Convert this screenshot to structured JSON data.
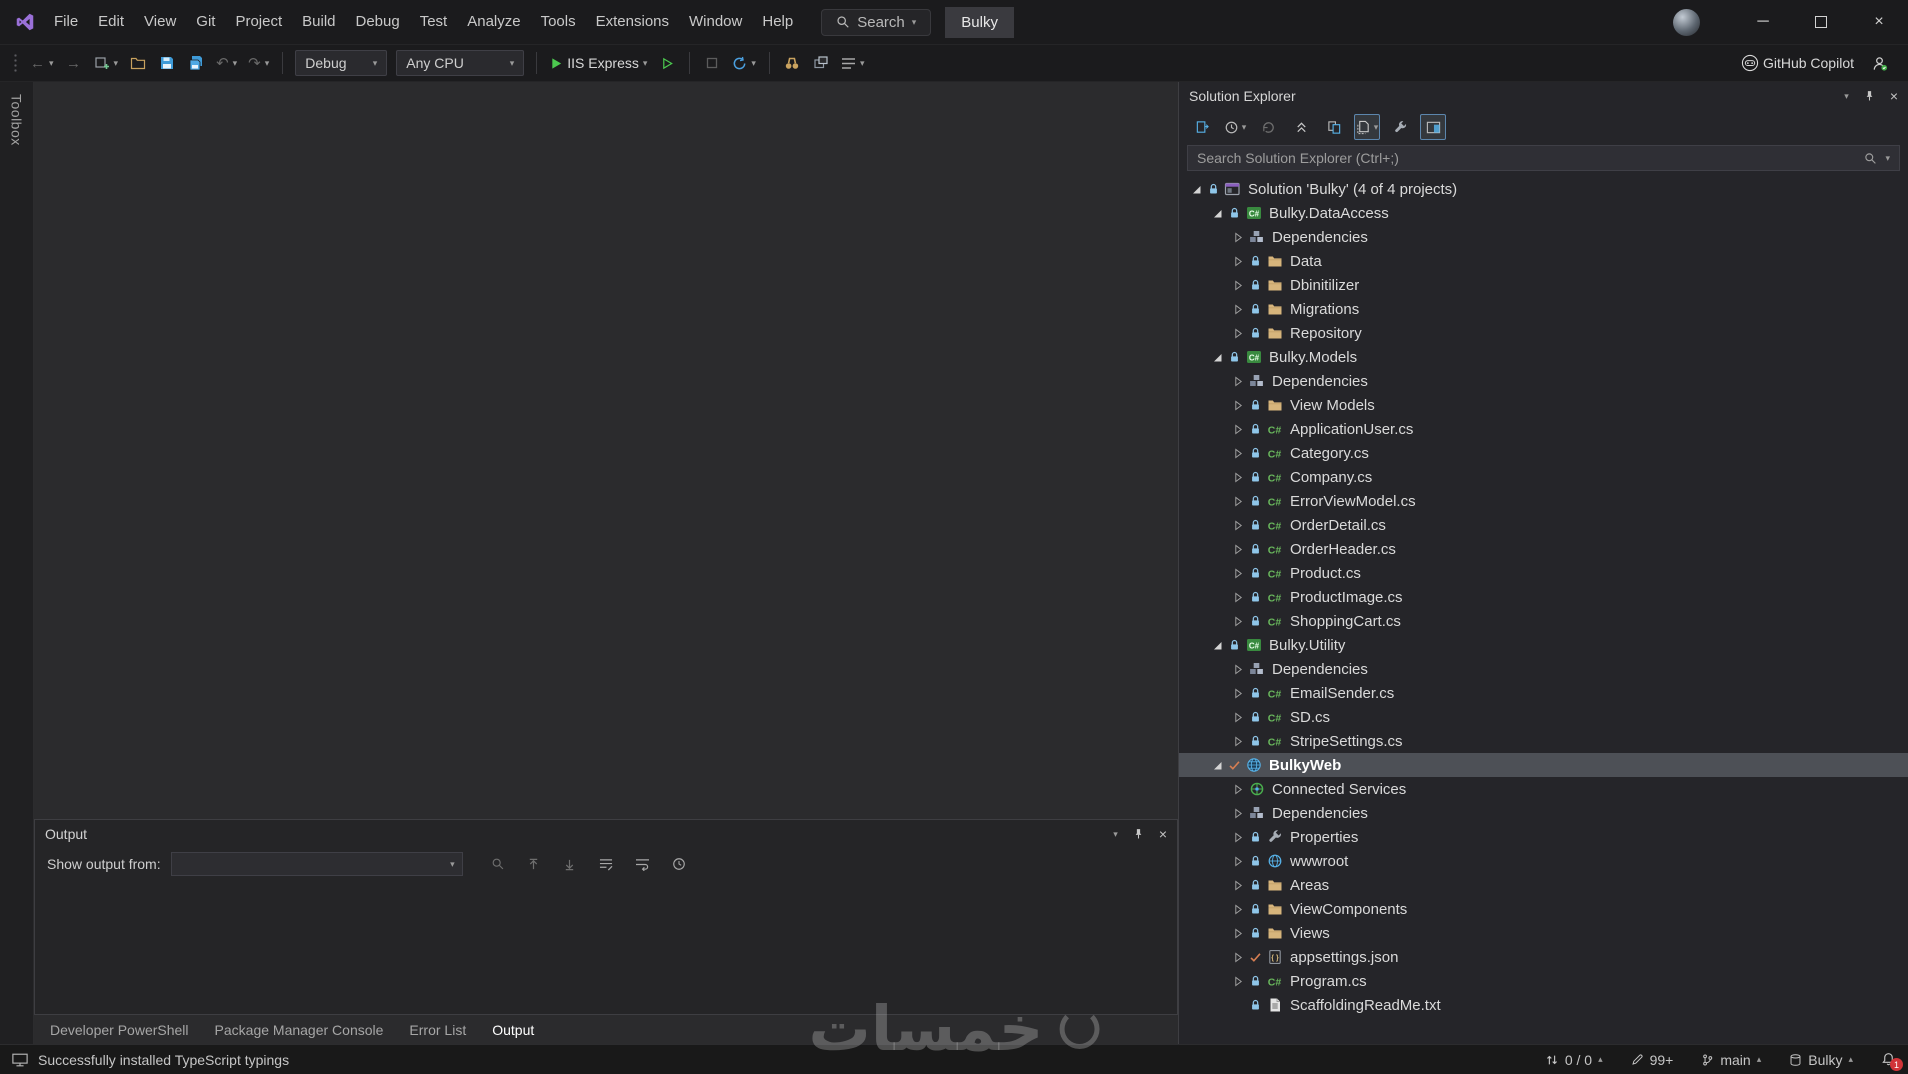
{
  "icons": {
    "caret_down": "▾",
    "caret_up": "▴",
    "close": "×",
    "minimize": "─",
    "back_arrow": "←",
    "forward_arrow": "→",
    "undo": "↶",
    "redo": "↷"
  },
  "accent_colors": {
    "folder": "#d7b57c",
    "csharp_green": "#69b75c",
    "run_green": "#4cc94f",
    "save_blue": "#3f9bd8",
    "lock_blue": "#8fc6e9",
    "check_orange": "#d67e52",
    "selection_gray": "#4d5056"
  },
  "titlebar": {
    "menus": [
      "File",
      "Edit",
      "View",
      "Git",
      "Project",
      "Build",
      "Debug",
      "Test",
      "Analyze",
      "Tools",
      "Extensions",
      "Window",
      "Help"
    ],
    "search": {
      "label": "Search"
    },
    "solution_name": "Bulky"
  },
  "toolbar": {
    "configuration": "Debug",
    "platform": "Any CPU",
    "start_button": "IIS Express",
    "copilot": "GitHub Copilot"
  },
  "left_rail": {
    "toolbox_label": "Toolbox"
  },
  "solution_explorer": {
    "title": "Solution Explorer",
    "search_placeholder": "Search Solution Explorer (Ctrl+;)",
    "tree": [
      {
        "label": "Solution 'Bulky' (4 of 4 projects)",
        "level": 0,
        "expand": "expanded",
        "lock": true,
        "icon": "solution"
      },
      {
        "label": "Bulky.DataAccess",
        "level": 1,
        "expand": "expanded",
        "lock": true,
        "icon": "csproject"
      },
      {
        "label": "Dependencies",
        "level": 2,
        "expand": "collapsed",
        "icon": "dependencies"
      },
      {
        "label": "Data",
        "level": 2,
        "expand": "collapsed",
        "lock": true,
        "icon": "folder"
      },
      {
        "label": "Dbinitilizer",
        "level": 2,
        "expand": "collapsed",
        "lock": true,
        "icon": "folder"
      },
      {
        "label": "Migrations",
        "level": 2,
        "expand": "collapsed",
        "lock": true,
        "icon": "folder"
      },
      {
        "label": "Repository",
        "level": 2,
        "expand": "collapsed",
        "lock": true,
        "icon": "folder"
      },
      {
        "label": "Bulky.Models",
        "level": 1,
        "expand": "expanded",
        "lock": true,
        "icon": "csproject"
      },
      {
        "label": "Dependencies",
        "level": 2,
        "expand": "collapsed",
        "icon": "dependencies"
      },
      {
        "label": "View Models",
        "level": 2,
        "expand": "collapsed",
        "lock": true,
        "icon": "folder"
      },
      {
        "label": "ApplicationUser.cs",
        "level": 2,
        "expand": "collapsed",
        "lock": true,
        "icon": "csharp"
      },
      {
        "label": "Category.cs",
        "level": 2,
        "expand": "collapsed",
        "lock": true,
        "icon": "csharp"
      },
      {
        "label": "Company.cs",
        "level": 2,
        "expand": "collapsed",
        "lock": true,
        "icon": "csharp"
      },
      {
        "label": "ErrorViewModel.cs",
        "level": 2,
        "expand": "collapsed",
        "lock": true,
        "icon": "csharp"
      },
      {
        "label": "OrderDetail.cs",
        "level": 2,
        "expand": "collapsed",
        "lock": true,
        "icon": "csharp"
      },
      {
        "label": "OrderHeader.cs",
        "level": 2,
        "expand": "collapsed",
        "lock": true,
        "icon": "csharp"
      },
      {
        "label": "Product.cs",
        "level": 2,
        "expand": "collapsed",
        "lock": true,
        "icon": "csharp"
      },
      {
        "label": "ProductImage.cs",
        "level": 2,
        "expand": "collapsed",
        "lock": true,
        "icon": "csharp"
      },
      {
        "label": "ShoppingCart.cs",
        "level": 2,
        "expand": "collapsed",
        "lock": true,
        "icon": "csharp"
      },
      {
        "label": "Bulky.Utility",
        "level": 1,
        "expand": "expanded",
        "lock": true,
        "icon": "csproject"
      },
      {
        "label": "Dependencies",
        "level": 2,
        "expand": "collapsed",
        "icon": "dependencies"
      },
      {
        "label": "EmailSender.cs",
        "level": 2,
        "expand": "collapsed",
        "lock": true,
        "icon": "csharp"
      },
      {
        "label": "SD.cs",
        "level": 2,
        "expand": "collapsed",
        "lock": true,
        "icon": "csharp"
      },
      {
        "label": "StripeSettings.cs",
        "level": 2,
        "expand": "collapsed",
        "lock": true,
        "icon": "csharp"
      },
      {
        "label": "BulkyWeb",
        "level": 1,
        "expand": "expanded",
        "check": true,
        "icon": "webproject",
        "selected": true,
        "bold": true
      },
      {
        "label": "Connected Services",
        "level": 2,
        "expand": "collapsed",
        "icon": "connected"
      },
      {
        "label": "Dependencies",
        "level": 2,
        "expand": "collapsed",
        "icon": "dependencies"
      },
      {
        "label": "Properties",
        "level": 2,
        "expand": "collapsed",
        "lock": true,
        "icon": "properties"
      },
      {
        "label": "wwwroot",
        "level": 2,
        "expand": "collapsed",
        "lock": true,
        "icon": "globe"
      },
      {
        "label": "Areas",
        "level": 2,
        "expand": "collapsed",
        "lock": true,
        "icon": "folder"
      },
      {
        "label": "ViewComponents",
        "level": 2,
        "expand": "collapsed",
        "lock": true,
        "icon": "folder"
      },
      {
        "label": "Views",
        "level": 2,
        "expand": "collapsed",
        "lock": true,
        "icon": "folder"
      },
      {
        "label": "appsettings.json",
        "level": 2,
        "expand": "collapsed",
        "check": true,
        "icon": "json"
      },
      {
        "label": "Program.cs",
        "level": 2,
        "expand": "collapsed",
        "lock": true,
        "icon": "csharp"
      },
      {
        "label": "ScaffoldingReadMe.txt",
        "level": 2,
        "expand": "none",
        "lock": true,
        "icon": "textfile"
      }
    ]
  },
  "output_panel": {
    "title": "Output",
    "show_output_from": "Show output from:",
    "source_value": "",
    "tabs": [
      {
        "label": "Developer PowerShell",
        "active": false
      },
      {
        "label": "Package Manager Console",
        "active": false
      },
      {
        "label": "Error List",
        "active": false
      },
      {
        "label": "Output",
        "active": true
      }
    ]
  },
  "status_bar": {
    "message": "Successfully installed TypeScript typings",
    "sync": "0 / 0",
    "pending_edits": "99+",
    "branch": "main",
    "repository": "Bulky",
    "notification_count": "1"
  },
  "watermark": "خمسات"
}
